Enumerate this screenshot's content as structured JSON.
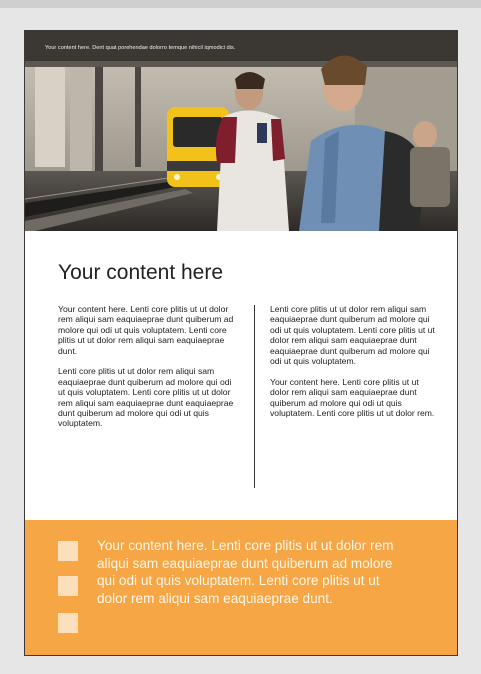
{
  "hero": {
    "caption": "Your content here. Dent quat porehendae dolorro temque nihicil iqmodici dis."
  },
  "title": "Your content here",
  "columns": {
    "left": [
      "Your content here. Lenti core plitis ut ut dolor rem aliqui sam eaquiaeprae dunt quiberum ad molore qui odi ut quis voluptatem. Lenti core plitis ut ut dolor rem aliqui sam eaquiaeprae dunt.",
      "Lenti core plitis ut ut dolor rem aliqui sam eaquiaeprae dunt quiberum ad molore qui odi ut quis voluptatem. Lenti core plitis ut ut dolor rem aliqui sam eaquiaeprae dunt eaquiaeprae dunt quiberum ad molore qui odi ut quis voluptatem."
    ],
    "right": [
      "Lenti core plitis ut ut dolor rem aliqui sam eaquiaeprae dunt quiberum ad molore qui odi ut quis voluptatem. Lenti core plitis ut ut dolor rem aliqui sam eaquiaeprae dunt eaquiaeprae dunt quiberum ad molore qui odi ut quis voluptatem.",
      "Your content here. Lenti core plitis ut ut dolor rem aliqui sam eaquiaeprae dunt quiberum ad molore qui odi ut quis voluptatem. Lenti core plitis ut ut dolor rem."
    ]
  },
  "band": {
    "text": "Your content here. Lenti core plitis ut ut dolor rem aliqui sam eaquiaeprae dunt quiberum ad molore qui odi ut quis voluptatem. Lenti core plitis ut ut dolor rem aliqui sam eaquiaeprae dunt."
  },
  "colors": {
    "accent": "#f6a644",
    "accent_light": "#fde0bb",
    "text": "#222222"
  }
}
